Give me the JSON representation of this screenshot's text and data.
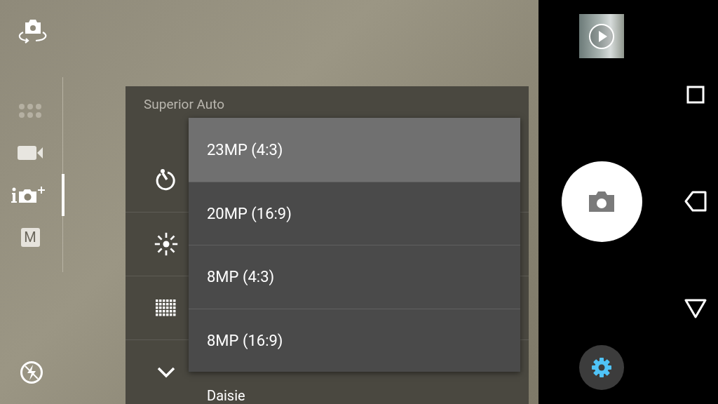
{
  "modes": [
    {
      "kind": "apps",
      "selected": false
    },
    {
      "kind": "video",
      "selected": false
    },
    {
      "kind": "superior_auto",
      "selected": true
    },
    {
      "kind": "manual",
      "label": "M",
      "selected": false
    }
  ],
  "settings_panel": {
    "title": "Superior Auto",
    "rows": [
      {
        "kind": "timer"
      },
      {
        "kind": "brightness"
      },
      {
        "kind": "grid"
      },
      {
        "kind": "expand",
        "value": "Daisie"
      }
    ]
  },
  "dropdown": {
    "options": [
      {
        "label": "23MP (4:3)",
        "selected": true
      },
      {
        "label": "20MP (16:9)",
        "selected": false
      },
      {
        "label": "8MP (4:3)",
        "selected": false
      },
      {
        "label": "8MP (16:9)",
        "selected": false
      }
    ]
  }
}
